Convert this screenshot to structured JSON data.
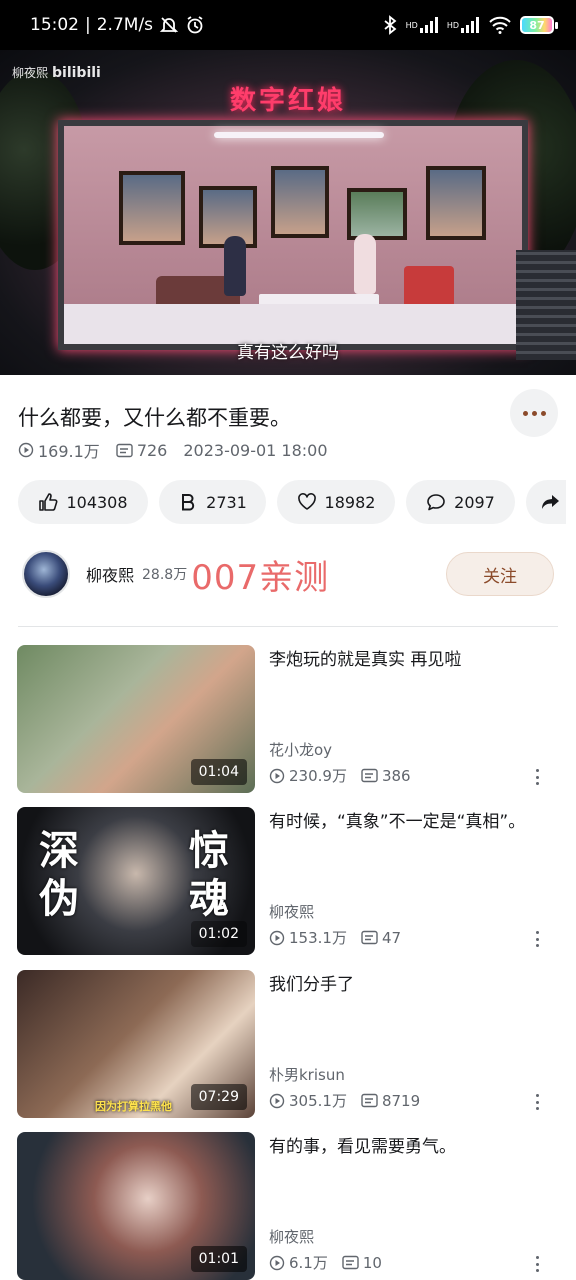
{
  "status_bar": {
    "time": "15:02",
    "speed": "2.7M/s",
    "signal1": "HD",
    "signal2": "HD",
    "battery": "87"
  },
  "video": {
    "watermark_user": "柳夜熙",
    "watermark_brand": "bilibili",
    "sign_text": "数字红娘",
    "subtitle": "真有这么好吗"
  },
  "info": {
    "title": "什么都要，又什么都不重要。",
    "views": "169.1万",
    "danmaku": "726",
    "date": "2023-09-01 18:00"
  },
  "actions": {
    "like": "104308",
    "coin": "2731",
    "favorite": "18982",
    "comment": "2097"
  },
  "uploader": {
    "name": "柳夜熙",
    "fans": "28.8万",
    "overlay": "007亲测",
    "follow_label": "关注"
  },
  "related": [
    {
      "title": "李炮玩的就是真实 再见啦",
      "author": "花小龙oy",
      "views": "230.9万",
      "danmaku": "386",
      "duration": "01:04"
    },
    {
      "title": "有时候，“真象”不一定是“真相”。",
      "author": "柳夜熙",
      "views": "153.1万",
      "danmaku": "47",
      "duration": "01:02",
      "caption_left": "深伪",
      "caption_right": "惊魂"
    },
    {
      "title": "我们分手了",
      "author": "朴男krisun",
      "views": "305.1万",
      "danmaku": "8719",
      "duration": "07:29",
      "caption_bottom": "因为打算拉黑他"
    },
    {
      "title": "有的事，看见需要勇气。",
      "author": "柳夜熙",
      "views": "6.1万",
      "danmaku": "10",
      "duration": "01:01"
    }
  ],
  "colors": {
    "accent_brown": "#8b4a2a",
    "overlay_red": "#e96a6a",
    "text_secondary": "#61666d"
  },
  "icons": [
    "mute-bell-icon",
    "alarm-icon",
    "bluetooth-icon",
    "signal-icon",
    "wifi-icon",
    "battery-icon",
    "play-count-icon",
    "danmaku-icon",
    "thumb-up-icon",
    "coin-icon",
    "heart-icon",
    "comment-icon",
    "share-icon",
    "more-icon"
  ]
}
